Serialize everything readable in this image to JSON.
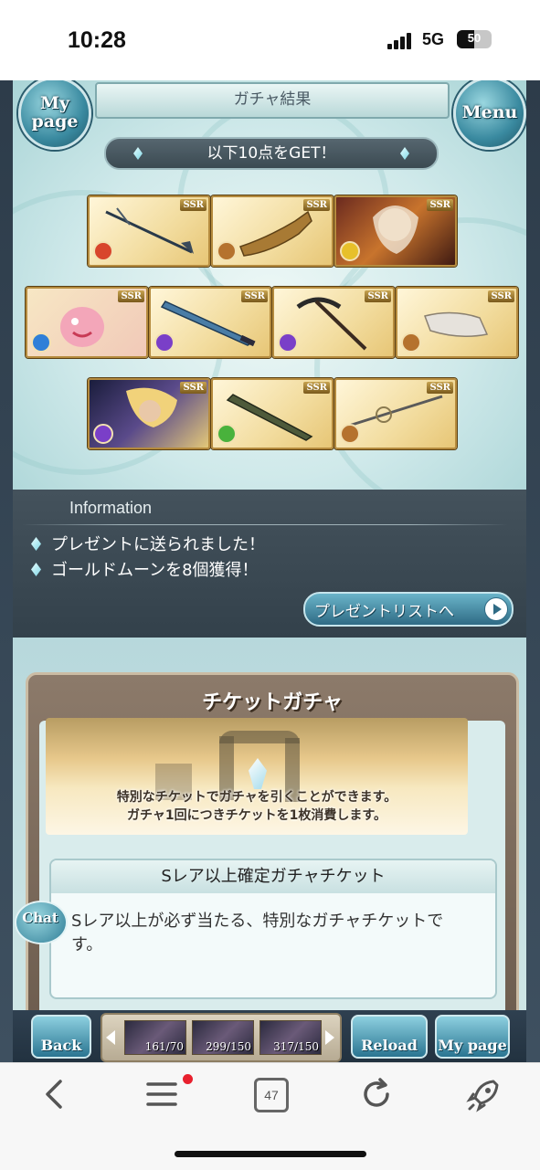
{
  "status_bar": {
    "time": "10:28",
    "network": "5G",
    "battery": "50"
  },
  "header": {
    "title": "ガチャ結果",
    "mypage_label": "My page",
    "menu_label": "Menu",
    "get_banner": "以下10点をGET！"
  },
  "cards": [
    {
      "rarity": "SSR",
      "kind": "weapon-spear",
      "element": "fire"
    },
    {
      "rarity": "SSR",
      "kind": "weapon-gauntlet",
      "element": "earth"
    },
    {
      "rarity": "SSR",
      "kind": "character-elder",
      "element": "light"
    },
    {
      "rarity": "SSR",
      "kind": "summon-pink-creature",
      "element": "water"
    },
    {
      "rarity": "SSR",
      "kind": "weapon-sword",
      "element": "dark"
    },
    {
      "rarity": "SSR",
      "kind": "weapon-scythe",
      "element": "dark"
    },
    {
      "rarity": "SSR",
      "kind": "weapon-gauntlet-white",
      "element": "earth"
    },
    {
      "rarity": "SSR",
      "kind": "character-blond",
      "element": "dark"
    },
    {
      "rarity": "SSR",
      "kind": "weapon-greatsword",
      "element": "wind"
    },
    {
      "rarity": "SSR",
      "kind": "weapon-spear-2",
      "element": "earth"
    }
  ],
  "information": {
    "heading": "Information",
    "lines": [
      "プレゼントに送られました！",
      "ゴールドムーンを8個獲得！"
    ],
    "present_button": "プレゼントリストへ"
  },
  "ticket_gacha": {
    "title": "チケットガチャ",
    "banner_line1": "特別なチケットでガチャを引くことができます。",
    "banner_line2": "ガチャ1回につきチケットを1枚消費します。",
    "ticket_name": "Sレア以上確定ガチャチケット",
    "ticket_desc": "Sレア以上が必ず当たる、特別なガチャチケットです。"
  },
  "chat_label": "Chat",
  "bottom_bar": {
    "back_label": "Back",
    "reload_label": "Reload",
    "mypage_label": "My page",
    "item_counts": [
      "161/70",
      "299/150",
      "317/150"
    ]
  },
  "browser": {
    "tab_count": "47"
  },
  "colors": {
    "element_fire": "#d8452c",
    "element_water": "#2f7fd8",
    "element_earth": "#b5722e",
    "element_wind": "#49b23c",
    "element_light": "#e7c02a",
    "element_dark": "#7a3fc8"
  }
}
